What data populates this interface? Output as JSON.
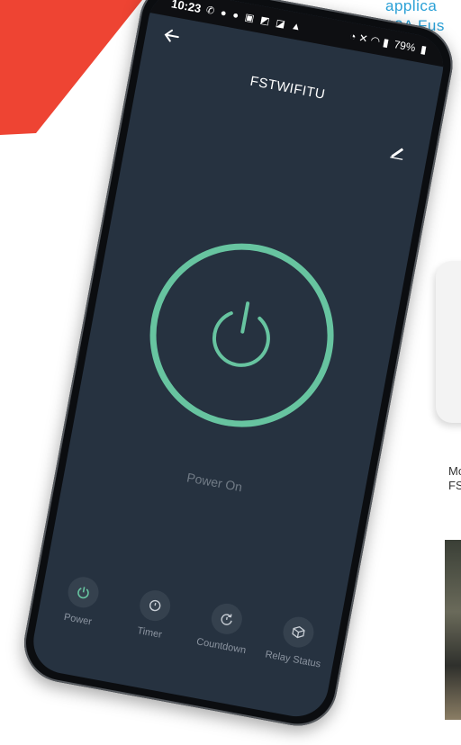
{
  "background": {
    "heading_lines": [
      "applica",
      "13A Fus"
    ],
    "model_lines": [
      "Mc",
      "FS"
    ]
  },
  "status_bar": {
    "time": "10:23",
    "battery": "79%"
  },
  "header": {
    "title": "FSTWIFITU"
  },
  "main": {
    "power_state": "Power On",
    "accent_color": "#67c4a0",
    "is_on": true
  },
  "navbar": {
    "items": [
      {
        "label": "Power",
        "icon": "power-icon",
        "active": true
      },
      {
        "label": "Timer",
        "icon": "timer-icon"
      },
      {
        "label": "Countdown",
        "icon": "countdown-icon"
      },
      {
        "label": "Relay Status",
        "icon": "relay-status-icon"
      }
    ]
  }
}
